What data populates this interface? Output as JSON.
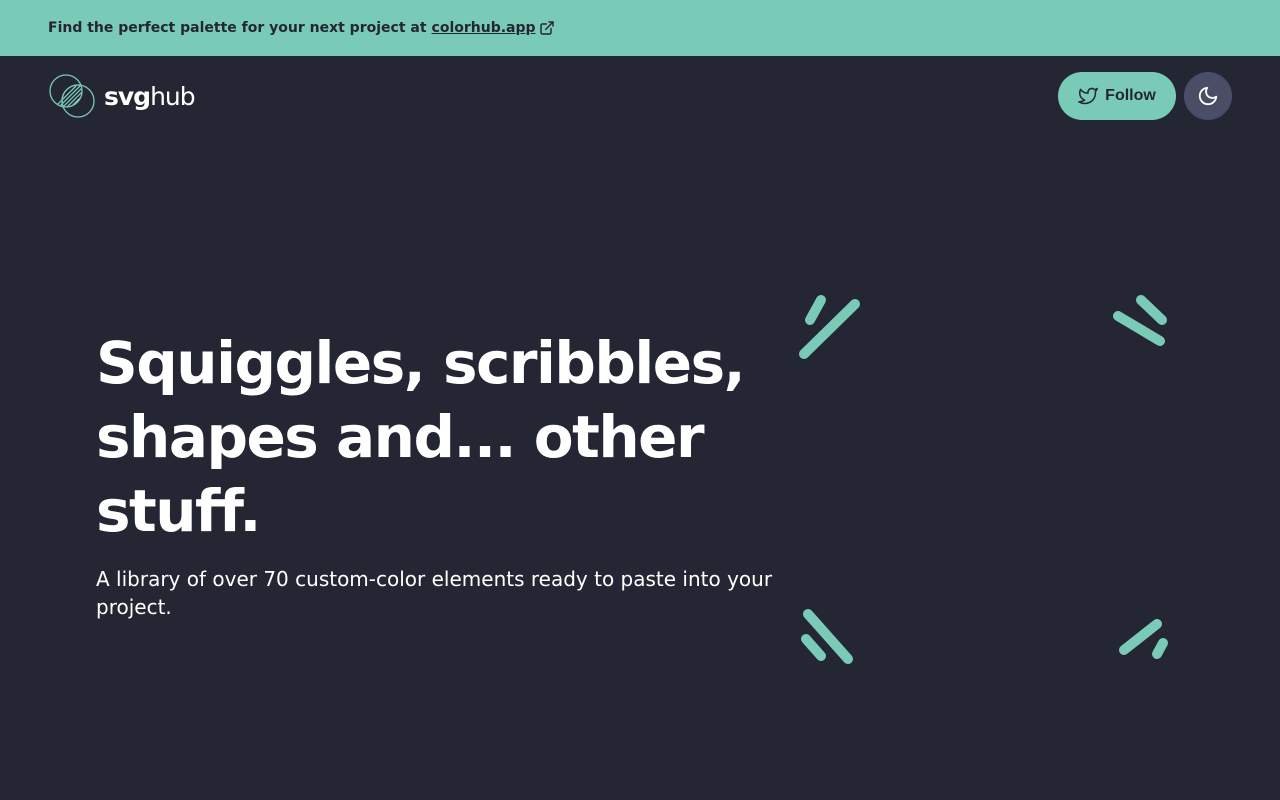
{
  "banner": {
    "text": "Find the perfect palette for your next project at",
    "link_text": "colorhub.app",
    "link_icon": "external-link-icon"
  },
  "header": {
    "logo_bold": "svg",
    "logo_light": "hub",
    "logo_icon": "svghub-logo-icon",
    "follow_label": "Follow",
    "follow_icon": "twitter-bird-icon",
    "theme_icon": "moon-icon"
  },
  "hero": {
    "title": "Squiggles, scribbles, shapes and... other stuff.",
    "subtitle": "A library of over 70 custom-color elements ready to paste into your project."
  },
  "colors": {
    "accent": "#79cbb8",
    "background": "#242633",
    "toggle_bg": "#4a4d66",
    "text": "#ffffff"
  }
}
